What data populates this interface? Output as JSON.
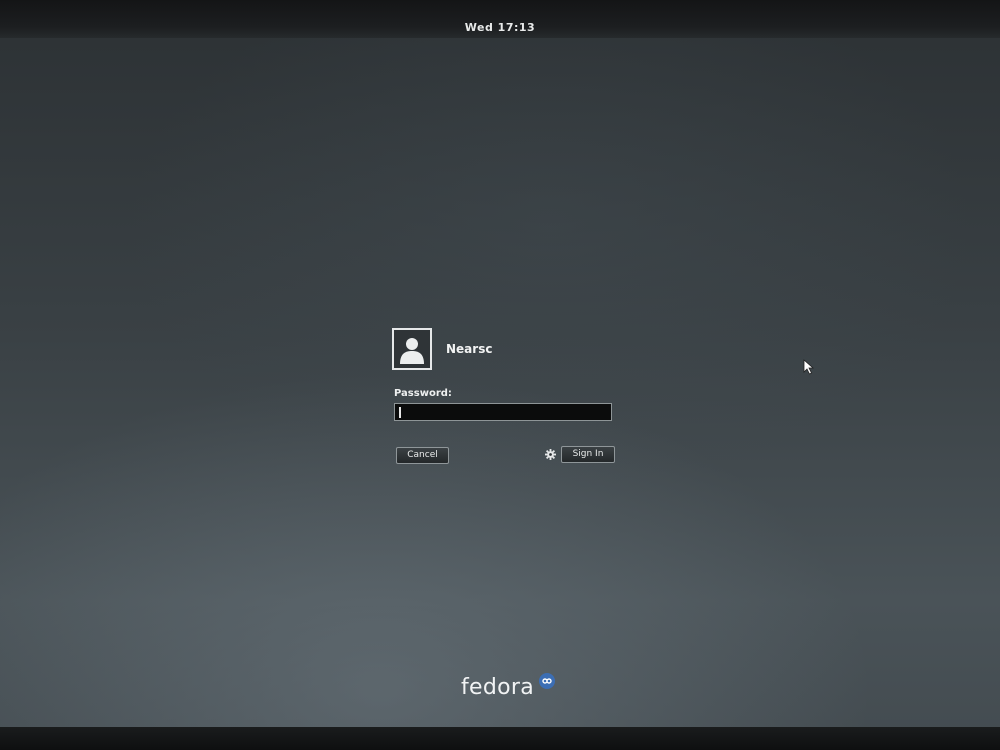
{
  "top_bar": {
    "clock": "Wed 17:13"
  },
  "login": {
    "username": "Nearsc",
    "password_label": "Password:",
    "password_value": "",
    "cancel_label": "Cancel",
    "signin_label": "Sign In"
  },
  "icons": {
    "avatar": "user-avatar-icon",
    "settings": "gear-icon",
    "cursor": "mouse-pointer-icon",
    "logo_mark": "fedora-infinity-icon"
  },
  "branding": {
    "logo_text": "fedora"
  },
  "colors": {
    "background": "#3a4145",
    "text": "#eef0f0",
    "input_bg": "#0b0c0c",
    "logo_accent": "#3c6eb4"
  }
}
